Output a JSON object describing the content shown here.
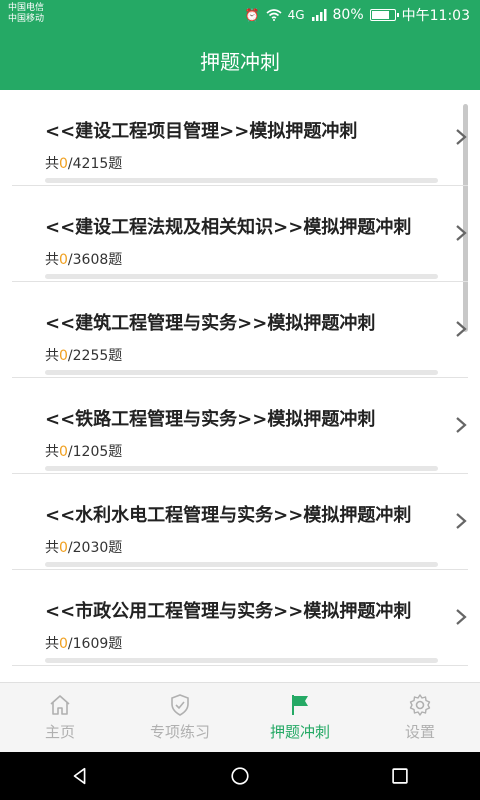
{
  "status": {
    "carrier1": "中国电信",
    "carrier2": "中国移动",
    "signal_label": "4G",
    "battery": "80%",
    "battery_level": 0.8,
    "time": "中午11:03"
  },
  "header": {
    "title": "押题冲刺"
  },
  "items": [
    {
      "title": "<<建设工程项目管理>>模拟押题冲刺",
      "count_prefix": "共",
      "done": "0",
      "total": "/4215题",
      "progress": 0
    },
    {
      "title": "<<建设工程法规及相关知识>>模拟押题冲刺",
      "count_prefix": "共",
      "done": "0",
      "total": "/3608题",
      "progress": 0
    },
    {
      "title": "<<建筑工程管理与实务>>模拟押题冲刺",
      "count_prefix": "共",
      "done": "0",
      "total": "/2255题",
      "progress": 0
    },
    {
      "title": "<<铁路工程管理与实务>>模拟押题冲刺",
      "count_prefix": "共",
      "done": "0",
      "total": "/1205题",
      "progress": 0
    },
    {
      "title": "<<水利水电工程管理与实务>>模拟押题冲刺",
      "count_prefix": "共",
      "done": "0",
      "total": "/2030题",
      "progress": 0
    },
    {
      "title": "<<市政公用工程管理与实务>>模拟押题冲刺",
      "count_prefix": "共",
      "done": "0",
      "total": "/1609题",
      "progress": 0
    }
  ],
  "tabs": [
    {
      "label": "主页",
      "icon": "home-icon"
    },
    {
      "label": "专项练习",
      "icon": "shield-check-icon"
    },
    {
      "label": "押题冲刺",
      "icon": "flag-icon",
      "active": true
    },
    {
      "label": "设置",
      "icon": "gear-icon"
    }
  ],
  "colors": {
    "primary": "#25a965",
    "accent_count": "#f0a020",
    "tab_inactive": "#b0b0b0"
  }
}
